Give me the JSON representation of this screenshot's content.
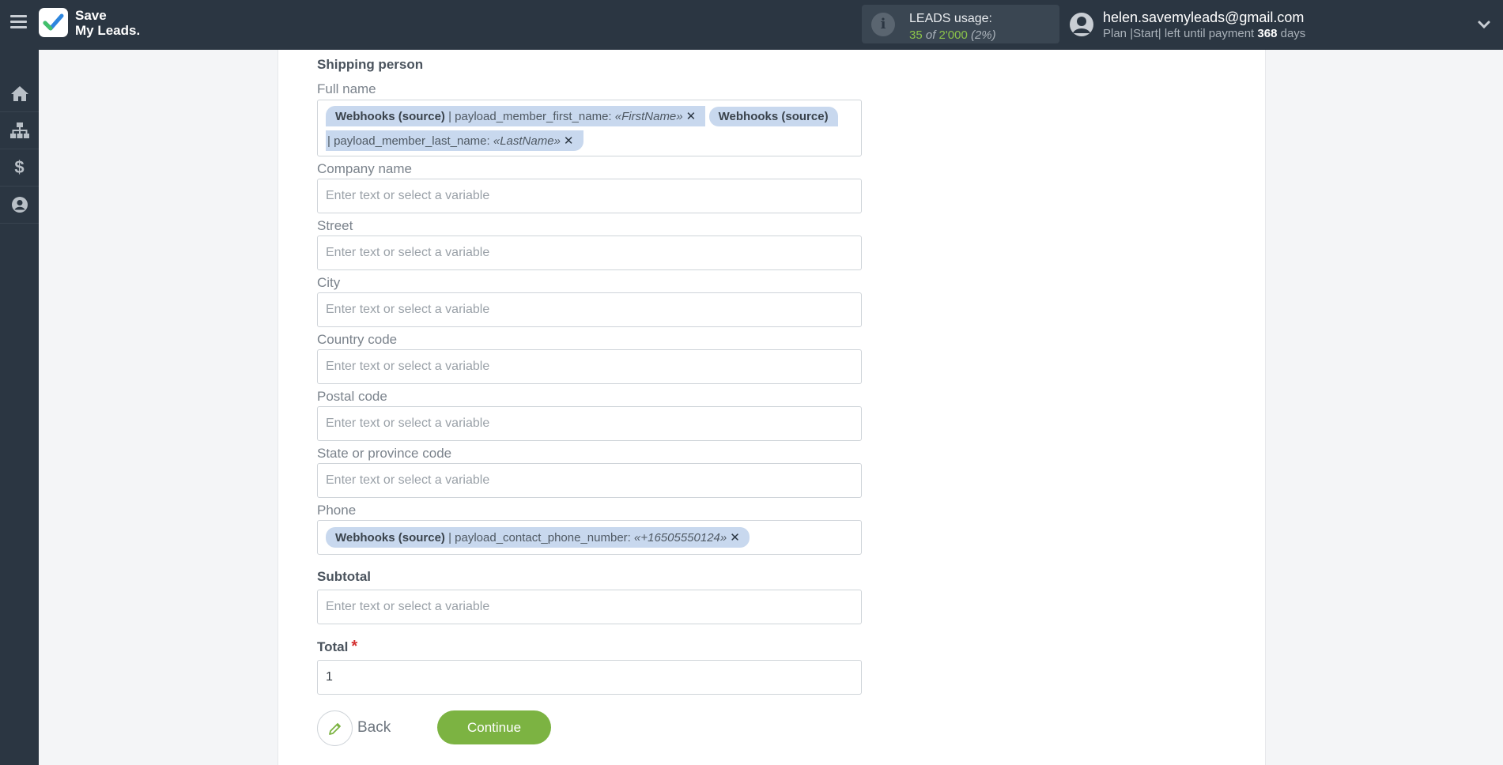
{
  "header": {
    "logo": {
      "line1": "Save",
      "line2": "My Leads."
    },
    "usage": {
      "title": "LEADS usage:",
      "used": "35",
      "of": "of",
      "limit": "2'000",
      "percent": "(2%)"
    },
    "user": {
      "email": "helen.savemyleads@gmail.com",
      "plan_prefix": "Plan |Start| left until payment",
      "days": "368",
      "days_suffix": "days"
    }
  },
  "sidebar": {
    "items": [
      {
        "icon": "home-icon"
      },
      {
        "icon": "sitemap-icon"
      },
      {
        "icon": "dollar-icon"
      },
      {
        "icon": "user-circle-icon"
      }
    ]
  },
  "form": {
    "section_title": "Shipping person",
    "placeholder": "Enter text or select a variable",
    "full_name": {
      "label": "Full name",
      "tags": [
        {
          "source": "Webhooks (source)",
          "sep": "| payload_member_first_name:",
          "value": "«FirstName»"
        },
        {
          "source": "Webhooks (source)",
          "sep": "| payload_member_last_name:",
          "value": "«LastName»"
        }
      ]
    },
    "company_name": {
      "label": "Company name"
    },
    "street": {
      "label": "Street"
    },
    "city": {
      "label": "City"
    },
    "country_code": {
      "label": "Country code"
    },
    "postal_code": {
      "label": "Postal code"
    },
    "state_code": {
      "label": "State or province code"
    },
    "phone": {
      "label": "Phone",
      "tags": [
        {
          "source": "Webhooks (source)",
          "sep": "| payload_contact_phone_number:",
          "value": "«+16505550124»"
        }
      ]
    },
    "subtotal": {
      "label": "Subtotal"
    },
    "total": {
      "label": "Total",
      "required_mark": "*",
      "value": "1"
    }
  },
  "actions": {
    "back_label": "Back",
    "continue_label": "Continue"
  },
  "colors": {
    "topbar": "#2b3642",
    "accent_green": "#7cb342",
    "tag_bg": "#c8d8ee"
  }
}
